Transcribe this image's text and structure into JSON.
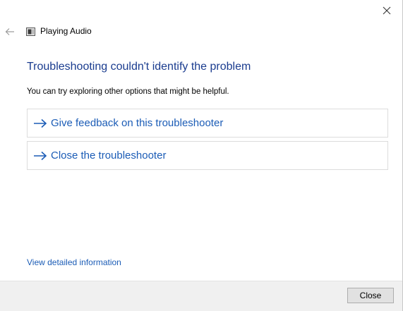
{
  "window": {
    "title": "Playing Audio",
    "close_glyph": "×"
  },
  "main": {
    "heading": "Troubleshooting couldn't identify the problem",
    "subtext": "You can try exploring other options that might be helpful.",
    "options": [
      {
        "label": "Give feedback on this troubleshooter",
        "icon": "arrow-right-icon"
      },
      {
        "label": "Close the troubleshooter",
        "icon": "arrow-right-icon"
      }
    ],
    "details_link": "View detailed information"
  },
  "footer": {
    "close_button_label": "Close"
  },
  "colors": {
    "heading": "#1a3c8f",
    "link": "#1b5cb6",
    "footer_bg": "#f0f0f0"
  }
}
